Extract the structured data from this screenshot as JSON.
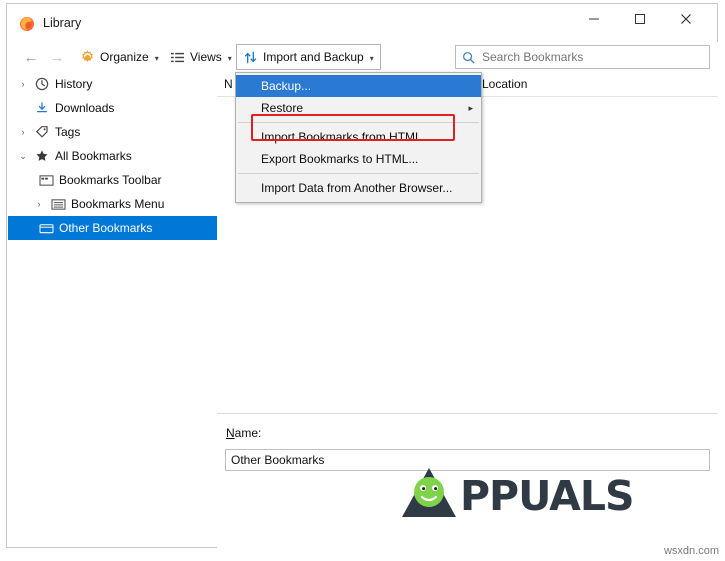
{
  "window": {
    "title": "Library",
    "app_icon": "firefox-library-icon",
    "minimize_label": "—",
    "maximize_label": "□",
    "close_label": "✕"
  },
  "toolbar": {
    "back_label": "←",
    "forward_label": "→",
    "organize_label": "Organize",
    "views_label": "Views",
    "import_label": "Import and Backup",
    "caret": "▾"
  },
  "search": {
    "placeholder": "Search Bookmarks",
    "value": "",
    "icon": "search-icon"
  },
  "sidebar": {
    "items": [
      {
        "label": "History",
        "icon": "clock-icon",
        "twisty": "›",
        "indent": 6,
        "selected": false
      },
      {
        "label": "Downloads",
        "icon": "download-icon",
        "twisty": "",
        "indent": 6,
        "selected": false
      },
      {
        "label": "Tags",
        "icon": "tag-icon",
        "twisty": "›",
        "indent": 6,
        "selected": false
      },
      {
        "label": "All Bookmarks",
        "icon": "star-icon",
        "twisty": "⌄",
        "indent": 6,
        "selected": false
      },
      {
        "label": "Bookmarks Toolbar",
        "icon": "toolbar-folder-icon",
        "twisty": "",
        "indent": 28,
        "selected": false
      },
      {
        "label": "Bookmarks Menu",
        "icon": "menu-folder-icon",
        "twisty": "›",
        "indent": 22,
        "selected": false
      },
      {
        "label": "Other Bookmarks",
        "icon": "other-folder-icon",
        "twisty": "",
        "indent": 28,
        "selected": true
      }
    ]
  },
  "columns": {
    "name": "N",
    "location": "Location"
  },
  "details": {
    "name_label": "Name:",
    "name_value": "Other Bookmarks"
  },
  "menu": {
    "items": [
      {
        "label": "Backup...",
        "mnemonic": "B",
        "highlight": true,
        "submenu": false,
        "sep_after": false
      },
      {
        "label": "Restore",
        "mnemonic": "R",
        "highlight": false,
        "submenu": true,
        "sep_after": true
      },
      {
        "label": "Import Bookmarks from HTML...",
        "mnemonic": "I",
        "highlight": false,
        "submenu": false,
        "sep_after": false
      },
      {
        "label": "Export Bookmarks to HTML...",
        "mnemonic": "E",
        "highlight": false,
        "submenu": false,
        "sep_after": true
      },
      {
        "label": "Import Data from Another Browser...",
        "mnemonic": "",
        "highlight": false,
        "submenu": false,
        "sep_after": false
      }
    ]
  },
  "annotation": {
    "highlight_color": "#e02020",
    "highlighted_item": "Import Bookmarks from HTML..."
  },
  "watermark": {
    "text": "PPUALS",
    "prefix": "A",
    "footer": "wsxdn.com"
  }
}
